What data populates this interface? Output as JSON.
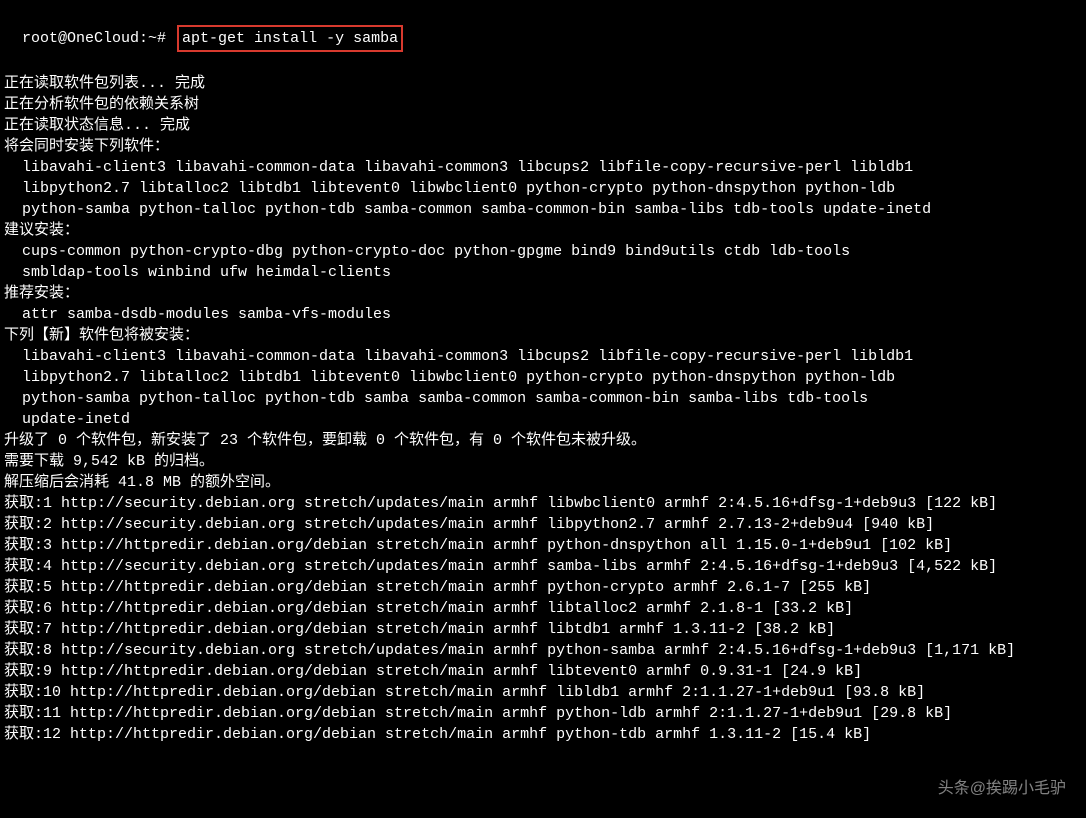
{
  "prompt": "root@OneCloud:~# ",
  "command": "apt-get install -y samba",
  "lines": [
    {
      "t": "正在读取软件包列表... 完成",
      "indent": false
    },
    {
      "t": "正在分析软件包的依赖关系树",
      "indent": false
    },
    {
      "t": "正在读取状态信息... 完成",
      "indent": false
    },
    {
      "t": "将会同时安装下列软件：",
      "indent": false
    },
    {
      "t": "libavahi-client3 libavahi-common-data libavahi-common3 libcups2 libfile-copy-recursive-perl libldb1",
      "indent": true
    },
    {
      "t": "libpython2.7 libtalloc2 libtdb1 libtevent0 libwbclient0 python-crypto python-dnspython python-ldb",
      "indent": true
    },
    {
      "t": "python-samba python-talloc python-tdb samba-common samba-common-bin samba-libs tdb-tools update-inetd",
      "indent": true
    },
    {
      "t": "建议安装：",
      "indent": false
    },
    {
      "t": "cups-common python-crypto-dbg python-crypto-doc python-gpgme bind9 bind9utils ctdb ldb-tools",
      "indent": true
    },
    {
      "t": "smbldap-tools winbind ufw heimdal-clients",
      "indent": true
    },
    {
      "t": "推荐安装：",
      "indent": false
    },
    {
      "t": "attr samba-dsdb-modules samba-vfs-modules",
      "indent": true
    },
    {
      "t": "下列【新】软件包将被安装：",
      "indent": false
    },
    {
      "t": "libavahi-client3 libavahi-common-data libavahi-common3 libcups2 libfile-copy-recursive-perl libldb1",
      "indent": true
    },
    {
      "t": "libpython2.7 libtalloc2 libtdb1 libtevent0 libwbclient0 python-crypto python-dnspython python-ldb",
      "indent": true
    },
    {
      "t": "python-samba python-talloc python-tdb samba samba-common samba-common-bin samba-libs tdb-tools",
      "indent": true
    },
    {
      "t": "update-inetd",
      "indent": true
    },
    {
      "t": "升级了 0 个软件包，新安装了 23 个软件包，要卸载 0 个软件包，有 0 个软件包未被升级。",
      "indent": false
    },
    {
      "t": "需要下载 9,542 kB 的归档。",
      "indent": false
    },
    {
      "t": "解压缩后会消耗 41.8 MB 的额外空间。",
      "indent": false
    },
    {
      "t": "获取:1 http://security.debian.org stretch/updates/main armhf libwbclient0 armhf 2:4.5.16+dfsg-1+deb9u3 [122 kB]",
      "indent": false
    },
    {
      "t": "获取:2 http://security.debian.org stretch/updates/main armhf libpython2.7 armhf 2.7.13-2+deb9u4 [940 kB]",
      "indent": false
    },
    {
      "t": "获取:3 http://httpredir.debian.org/debian stretch/main armhf python-dnspython all 1.15.0-1+deb9u1 [102 kB]",
      "indent": false
    },
    {
      "t": "获取:4 http://security.debian.org stretch/updates/main armhf samba-libs armhf 2:4.5.16+dfsg-1+deb9u3 [4,522 kB]",
      "indent": false
    },
    {
      "t": "获取:5 http://httpredir.debian.org/debian stretch/main armhf python-crypto armhf 2.6.1-7 [255 kB]",
      "indent": false
    },
    {
      "t": "获取:6 http://httpredir.debian.org/debian stretch/main armhf libtalloc2 armhf 2.1.8-1 [33.2 kB]",
      "indent": false
    },
    {
      "t": "获取:7 http://httpredir.debian.org/debian stretch/main armhf libtdb1 armhf 1.3.11-2 [38.2 kB]",
      "indent": false
    },
    {
      "t": "获取:8 http://security.debian.org stretch/updates/main armhf python-samba armhf 2:4.5.16+dfsg-1+deb9u3 [1,171 kB]",
      "indent": false
    },
    {
      "t": "获取:9 http://httpredir.debian.org/debian stretch/main armhf libtevent0 armhf 0.9.31-1 [24.9 kB]",
      "indent": false
    },
    {
      "t": "获取:10 http://httpredir.debian.org/debian stretch/main armhf libldb1 armhf 2:1.1.27-1+deb9u1 [93.8 kB]",
      "indent": false
    },
    {
      "t": "获取:11 http://httpredir.debian.org/debian stretch/main armhf python-ldb armhf 2:1.1.27-1+deb9u1 [29.8 kB]",
      "indent": false
    },
    {
      "t": "获取:12 http://httpredir.debian.org/debian stretch/main armhf python-tdb armhf 1.3.11-2 [15.4 kB]",
      "indent": false
    }
  ],
  "watermark": "头条@挨踢小毛驴"
}
